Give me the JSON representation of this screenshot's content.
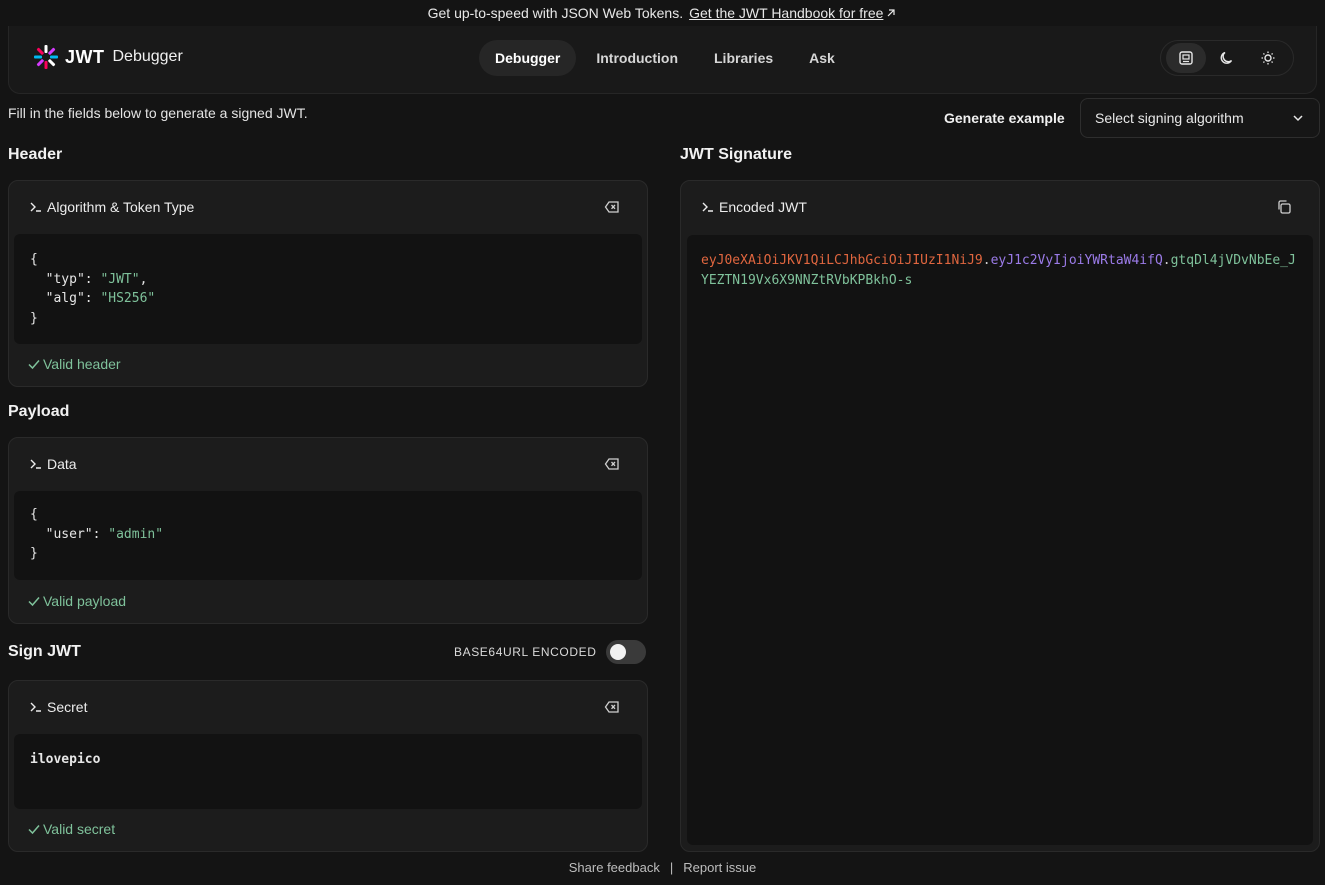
{
  "banner": {
    "text": "Get up-to-speed with JSON Web Tokens.",
    "link_label": "Get the JWT Handbook for free"
  },
  "nav": {
    "logo_word": "JWT",
    "logo_sub": "Debugger",
    "tabs": [
      {
        "label": "Debugger",
        "active": true
      },
      {
        "label": "Introduction"
      },
      {
        "label": "Libraries"
      },
      {
        "label": "Ask"
      }
    ],
    "theme_options": [
      "system-icon",
      "moon-icon",
      "sun-icon"
    ]
  },
  "intro": "Fill in the fields below to generate a signed JWT.",
  "generate": {
    "label": "Generate example",
    "select_placeholder": "Select signing algorithm"
  },
  "header_section": {
    "title": "Header",
    "panel_title": "Algorithm & Token Type",
    "code": {
      "open": "{",
      "lines": [
        {
          "key": "\"typ\"",
          "value": "\"JWT\"",
          "comma": ","
        },
        {
          "key": "\"alg\"",
          "value": "\"HS256\"",
          "comma": ""
        }
      ],
      "close": "}"
    },
    "status": "Valid header"
  },
  "payload_section": {
    "title": "Payload",
    "panel_title": "Data",
    "code": {
      "open": "{",
      "lines": [
        {
          "key": "\"user\"",
          "value": "\"admin\"",
          "comma": ""
        }
      ],
      "close": "}"
    },
    "status": "Valid payload"
  },
  "sign_section": {
    "title": "Sign JWT",
    "toggle_label": "BASE64URL ENCODED",
    "toggle_on": false,
    "panel_title": "Secret",
    "secret": "ilovepico",
    "status": "Valid secret"
  },
  "signature_section": {
    "title": "JWT Signature",
    "panel_title": "Encoded JWT",
    "jwt_header": "eyJ0eXAiOiJKV1QiLCJhbGciOiJIUzI1NiJ9",
    "jwt_payload": "eyJ1c2VyIjoiYWRtaW4ifQ",
    "jwt_signature": "gtqDl4jVDvNbEe_JYEZTN19Vx6X9NNZtRVbKPBkhO-s",
    "dot": "."
  },
  "footer": {
    "feedback": "Share feedback",
    "separator": "|",
    "report": "Report issue"
  },
  "colors": {
    "background": "#141414",
    "valid_green": "#7fc29b",
    "jwt_header_color": "#e0663f",
    "jwt_payload_color": "#9b7be8"
  }
}
